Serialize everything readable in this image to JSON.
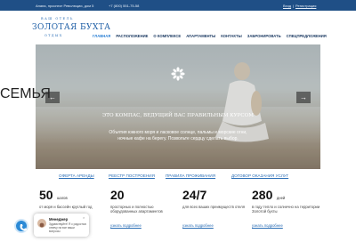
{
  "topbar": {
    "address": "Анапа, проспект Революции, дом 5",
    "phone": "+7 (800) 551-75-58",
    "login": "Вход",
    "separator": "|",
    "register": "Регистрация"
  },
  "logo": {
    "small": "ВАШ ОТЕЛЬ",
    "main": "ЗОЛОТАЯ БУХТА",
    "sub": "ОТДЫХ"
  },
  "nav": {
    "items": [
      {
        "label": "ГЛАВНАЯ",
        "active": true
      },
      {
        "label": "РАСПОЛОЖЕНИЕ",
        "active": false
      },
      {
        "label": "О КОМПЛЕКСЕ",
        "active": false
      },
      {
        "label": "АПАРТАМЕНТЫ",
        "active": false
      },
      {
        "label": "КОНТАКТЫ",
        "active": false
      },
      {
        "label": "ЗАБРОНИРОВАТЬ",
        "active": false
      },
      {
        "label": "СПЕЦПРЕДЛОЖЕНИЯ",
        "active": false
      }
    ]
  },
  "hero": {
    "title": "СЕМЬЯ",
    "subtitle": "ЭТО КОМПАС, ВЕДУЩИЙ ВАС ПРАВИЛЬНЫМ КУРСОМ",
    "desc_line1": "Объятия южного моря и ласковое солнце, пальмы и морские огни,",
    "desc_line2": "ночные кафе на берегу. Позвольте сердцу сделать выбор.",
    "prev_icon": "arrow-left-icon",
    "next_icon": "arrow-right-icon"
  },
  "links": [
    "ОФЕРТА АРЕНДЫ",
    "РЕЕСТР ПОСТРОЕНИЯ",
    "ПРАВИЛА ПРОЖИВАНИЯ",
    "ДОГОВОР ОКАЗАНИЯ УСЛУГ"
  ],
  "stats": [
    {
      "num": "50",
      "unit": "шагов",
      "desc": "от моря и бассейн круглый год",
      "more": "узнать подробнее"
    },
    {
      "num": "20",
      "unit": "",
      "desc": "просторных и полностью оборудованных апартаментов",
      "more": "узнать подробнее"
    },
    {
      "num": "24/7",
      "unit": "",
      "desc": "для всех ваших преимуществ отеля",
      "more": "узнать подробнее"
    },
    {
      "num": "280",
      "unit": "дней",
      "desc": "в году тепло и солнечно на территории Золотой бухты",
      "more": "узнать подробнее"
    }
  ],
  "chat": {
    "name": "Менеджер",
    "message": "Здравствуйте! Я с радостью отвечу на все ваши вопросы",
    "close": "×"
  },
  "colors": {
    "topbar": "#1f4f86",
    "accent": "#2a7fd4",
    "link": "#2a6db5"
  }
}
